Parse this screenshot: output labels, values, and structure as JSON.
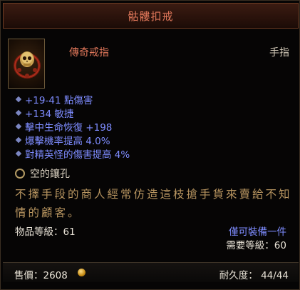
{
  "item": {
    "name": "骷髏扣戒",
    "type": "傳奇戒指",
    "slot": "手指",
    "icon": "skull-ring-icon"
  },
  "stats": [
    "+19-41 點傷害",
    "+134 敏捷",
    "擊中生命恢復 +198",
    "爆擊機率提高 4.0%",
    "對精英怪的傷害提高 4%"
  ],
  "socket": {
    "label": "空的鑲孔"
  },
  "flavor": "不擇手段的商人經常仿造這枝搶手貨來賣給不知情的顧客。",
  "item_level": "物品等級：61",
  "account_bound": "僅可裝備一件",
  "required_level": "需要等級：60",
  "footer": {
    "price": "售價：2608",
    "durability": "耐久度：  44/44"
  },
  "colors": {
    "legendary": "#e0775a",
    "magic_stat": "#7e8cff",
    "flavor": "#b89560",
    "gold": "#c48a14"
  }
}
